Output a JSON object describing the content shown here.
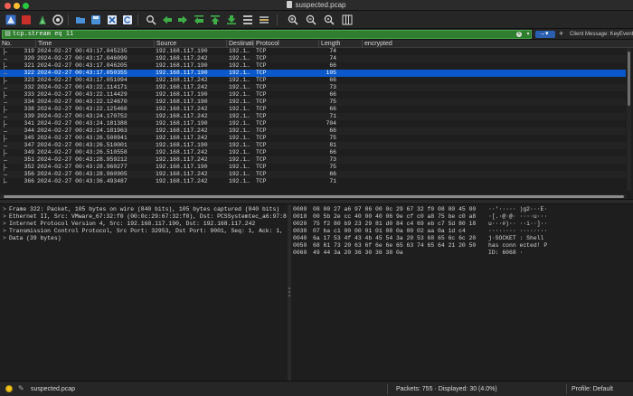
{
  "window": {
    "title": "suspected.pcap"
  },
  "filter": {
    "value": "tcp.stream eq 11",
    "button_label": "Client Message: KeyEvent"
  },
  "packet_list": {
    "columns": [
      "No.",
      "Time",
      "Source",
      "Destinati",
      "Protocol",
      "Length",
      "encrypted"
    ],
    "rows": [
      {
        "no": "319",
        "time": "2024-02-27 00:43:17.045235",
        "src": "192.168.117.190",
        "dst": "192.1…",
        "proto": "TCP",
        "len": "74",
        "info": ""
      },
      {
        "no": "320",
        "time": "2024-02-27 00:43:17.046099",
        "src": "192.168.117.242",
        "dst": "192.1…",
        "proto": "TCP",
        "len": "74",
        "info": ""
      },
      {
        "no": "321",
        "time": "2024-02-27 00:43:17.046205",
        "src": "192.168.117.190",
        "dst": "192.1…",
        "proto": "TCP",
        "len": "66",
        "info": ""
      },
      {
        "no": "322",
        "time": "2024-02-27 00:43:17.050355",
        "src": "192.168.117.190",
        "dst": "192.1…",
        "proto": "TCP",
        "len": "105",
        "info": ""
      },
      {
        "no": "323",
        "time": "2024-02-27 00:43:17.051094",
        "src": "192.168.117.242",
        "dst": "192.1…",
        "proto": "TCP",
        "len": "66",
        "info": ""
      },
      {
        "no": "332",
        "time": "2024-02-27 00:43:22.114171",
        "src": "192.168.117.242",
        "dst": "192.1…",
        "proto": "TCP",
        "len": "73",
        "info": ""
      },
      {
        "no": "333",
        "time": "2024-02-27 00:43:22.114429",
        "src": "192.168.117.190",
        "dst": "192.1…",
        "proto": "TCP",
        "len": "66",
        "info": ""
      },
      {
        "no": "334",
        "time": "2024-02-27 00:43:22.124670",
        "src": "192.168.117.190",
        "dst": "192.1…",
        "proto": "TCP",
        "len": "75",
        "info": ""
      },
      {
        "no": "338",
        "time": "2024-02-27 00:43:22.125468",
        "src": "192.168.117.242",
        "dst": "192.1…",
        "proto": "TCP",
        "len": "66",
        "info": ""
      },
      {
        "no": "339",
        "time": "2024-02-27 00:43:24.170752",
        "src": "192.168.117.242",
        "dst": "192.1…",
        "proto": "TCP",
        "len": "71",
        "info": ""
      },
      {
        "no": "341",
        "time": "2024-02-27 00:43:24.181388",
        "src": "192.168.117.190",
        "dst": "192.1…",
        "proto": "TCP",
        "len": "704",
        "info": ""
      },
      {
        "no": "344",
        "time": "2024-02-27 00:43:24.181963",
        "src": "192.168.117.242",
        "dst": "192.1…",
        "proto": "TCP",
        "len": "66",
        "info": ""
      },
      {
        "no": "345",
        "time": "2024-02-27 00:43:26.508941",
        "src": "192.168.117.242",
        "dst": "192.1…",
        "proto": "TCP",
        "len": "75",
        "info": ""
      },
      {
        "no": "347",
        "time": "2024-02-27 00:43:26.510001",
        "src": "192.168.117.190",
        "dst": "192.1…",
        "proto": "TCP",
        "len": "81",
        "info": ""
      },
      {
        "no": "349",
        "time": "2024-02-27 00:43:26.510558",
        "src": "192.168.117.242",
        "dst": "192.1…",
        "proto": "TCP",
        "len": "66",
        "info": ""
      },
      {
        "no": "351",
        "time": "2024-02-27 00:43:28.959212",
        "src": "192.168.117.242",
        "dst": "192.1…",
        "proto": "TCP",
        "len": "73",
        "info": ""
      },
      {
        "no": "352",
        "time": "2024-02-27 00:43:28.960277",
        "src": "192.168.117.190",
        "dst": "192.1…",
        "proto": "TCP",
        "len": "75",
        "info": ""
      },
      {
        "no": "356",
        "time": "2024-02-27 00:43:28.960905",
        "src": "192.168.117.242",
        "dst": "192.1…",
        "proto": "TCP",
        "len": "66",
        "info": ""
      },
      {
        "no": "366",
        "time": "2024-02-27 00:43:36.493487",
        "src": "192.168.117.242",
        "dst": "192.1…",
        "proto": "TCP",
        "len": "71",
        "info": ""
      }
    ]
  },
  "details": [
    "Frame 322: Packet, 105 bytes on wire (840 bits), 105 bytes captured (840 bits)",
    "Ethernet II, Src: VMware_67:32:f0 (00:0c:29:67:32:f0), Dst: PCSSystemtec_a6:97:8",
    "Internet Protocol Version 4, Src: 192.168.117.190, Dst: 192.168.117.242",
    "Transmission Control Protocol, Src Port: 32953, Dst Port: 9001, Seq: 1, Ack: 1,",
    "Data (39 bytes)"
  ],
  "bytes": [
    {
      "offset": "0000",
      "hex": "08 00 27 a6 97 86 00 0c  29 67 32 f0 08 00 45 00",
      "ascii": "··'·····  )g2···E·"
    },
    {
      "offset": "0010",
      "hex": "00 5b 2e cc 40 00 40 06  9e cf c0 a8 75 be c0 a8",
      "ascii": "·[.·@·@·  ····u···"
    },
    {
      "offset": "0020",
      "hex": "75 f2 80 b9 23 29 81 d0  84 c4 69 eb c7 5d 80 18",
      "ascii": "u···#)··  ··i··]··"
    },
    {
      "offset": "0030",
      "hex": "07 ba c1 00 00 01 01  08 0a 00 02 aa 0a 1d c4",
      "ascii": "········  ········"
    },
    {
      "offset": "0040",
      "hex": "6a 17 53 4f 43 4b 45 54  3a 20 53 68 65 6c 6c 20",
      "ascii": "j·SOCKET  : Shell "
    },
    {
      "offset": "0050",
      "hex": "68 61 73 20 63 6f 6e 6e  65 63 74 65 64 21 20 50",
      "ascii": "has conn  ected! P"
    },
    {
      "offset": "0060",
      "hex": "49 44 3a 20 36 30 36 38  0a",
      "ascii": "ID: 6068  ·"
    }
  ],
  "status": {
    "file": "suspected.pcap",
    "packets": "Packets: 755 · Displayed: 30 (4.0%)",
    "profile": "Profile: Default"
  },
  "colors": {
    "selection": "#0a58ca",
    "filter_valid": "#2f7d2f",
    "background": "#1e1e1e"
  },
  "toolbar_icons": [
    "shark-fin-start-icon",
    "stop-icon",
    "restart-icon",
    "options-icon",
    "open-folder-icon",
    "save-icon",
    "close-file-icon",
    "reload-icon",
    "find-icon",
    "back-icon",
    "forward-icon",
    "goto-icon",
    "first-packet-icon",
    "last-packet-icon",
    "autoscroll-icon",
    "colorize-icon",
    "zoom-in-icon",
    "zoom-out-icon",
    "zoom-reset-icon",
    "resize-columns-icon"
  ]
}
